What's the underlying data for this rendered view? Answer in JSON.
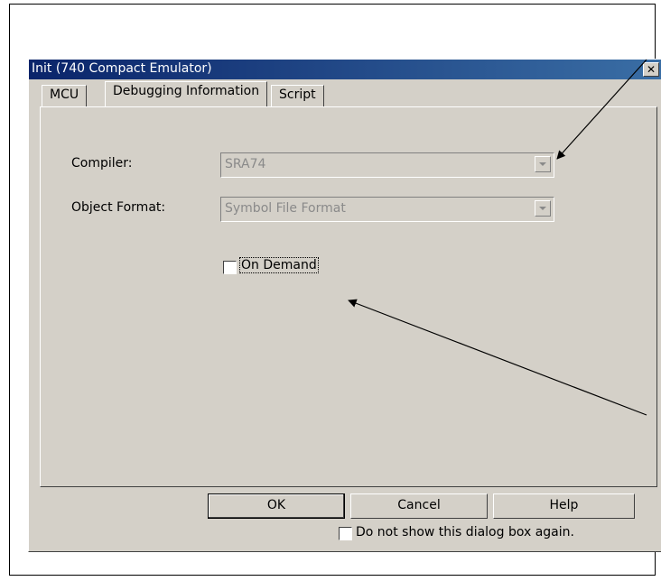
{
  "dialog": {
    "title": "Init (740 Compact Emulator)",
    "close_glyph": "✕"
  },
  "tabs": [
    {
      "label": "MCU"
    },
    {
      "label": "Debugging Information"
    },
    {
      "label": "Script"
    }
  ],
  "form": {
    "compiler_label": "Compiler:",
    "compiler_value": "SRA74",
    "object_format_label": "Object Format:",
    "object_format_value": "Symbol File Format",
    "on_demand_label": "On Demand"
  },
  "buttons": {
    "ok": "OK",
    "cancel": "Cancel",
    "help": "Help"
  },
  "footer": {
    "dont_show_label": "Do not show this dialog box again."
  }
}
